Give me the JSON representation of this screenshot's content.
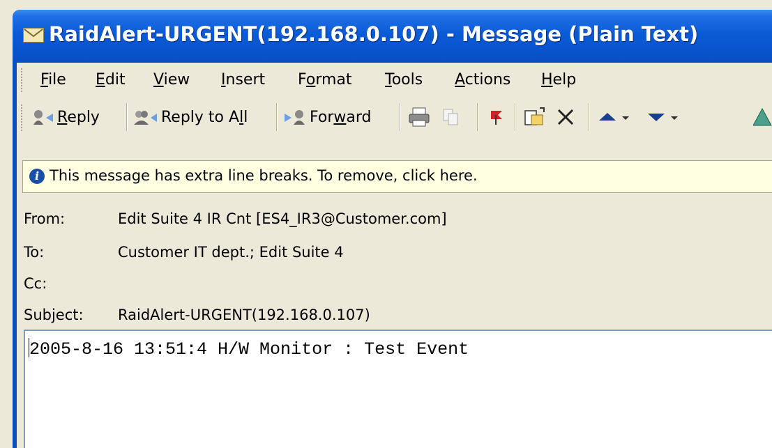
{
  "window": {
    "title": "RaidAlert-URGENT(192.168.0.107) - Message (Plain Text)"
  },
  "menu": [
    {
      "label": "File",
      "accel": "F",
      "rest": "ile"
    },
    {
      "label": "Edit",
      "accel": "E",
      "rest": "dit"
    },
    {
      "label": "View",
      "accel": "V",
      "rest": "iew"
    },
    {
      "label": "Insert",
      "accel": "I",
      "rest": "nsert"
    },
    {
      "label": "Format",
      "pre": "F",
      "accel": "o",
      "rest": "rmat"
    },
    {
      "label": "Tools",
      "accel": "T",
      "rest": "ools"
    },
    {
      "label": "Actions",
      "accel": "A",
      "rest": "ctions"
    },
    {
      "label": "Help",
      "accel": "H",
      "rest": "elp"
    }
  ],
  "toolbar": {
    "reply_accel": "R",
    "reply_rest": "eply",
    "reply_all_pre": "Reply to A",
    "reply_all_accel": "l",
    "reply_all_rest": "l",
    "forward_pre": "For",
    "forward_accel": "w",
    "forward_rest": "ard"
  },
  "infobar": {
    "text": "This message has extra line breaks. To remove, click here."
  },
  "headers": {
    "from_label": "From:",
    "from_value": "Edit Suite 4 IR Cnt [ES4_IR3@Customer.com]",
    "to_label": "To:",
    "to_value": "Customer IT dept.; Edit Suite 4",
    "cc_label": "Cc:",
    "cc_value": "",
    "subject_label": "Subject:",
    "subject_value": "RaidAlert-URGENT(192.168.0.107)"
  },
  "message": {
    "body": "2005-8-16 13:51:4 H/W Monitor : Test Event"
  },
  "colors": {
    "titlebar": "#0a5bd6",
    "chrome": "#ece9d8",
    "infobar": "#ffffe1"
  }
}
